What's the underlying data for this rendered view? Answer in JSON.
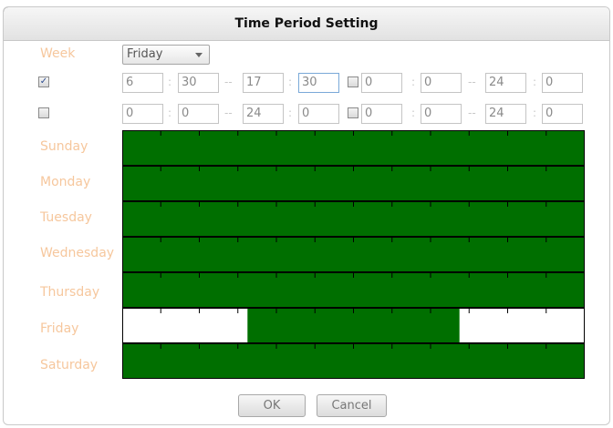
{
  "dialog": {
    "title": "Time Period Setting",
    "ok_label": "OK",
    "cancel_label": "Cancel"
  },
  "week": {
    "label": "Week",
    "selected": "Friday"
  },
  "separators": {
    "colon": ":",
    "dash": "--"
  },
  "period_rows": [
    {
      "checked": true,
      "check_glyph": "✓",
      "p1": {
        "sh": "6",
        "sm": "30",
        "eh": "17",
        "em": "30"
      },
      "p2_checked": false,
      "p2": {
        "sh": "0",
        "sm": "0",
        "eh": "24",
        "em": "0"
      }
    },
    {
      "checked": false,
      "check_glyph": "",
      "p1": {
        "sh": "0",
        "sm": "0",
        "eh": "24",
        "em": "0"
      },
      "p2_checked": false,
      "p2": {
        "sh": "0",
        "sm": "0",
        "eh": "24",
        "em": "0"
      }
    }
  ],
  "days": [
    "Sunday",
    "Monday",
    "Tuesday",
    "Wednesday",
    "Thursday",
    "Friday",
    "Saturday"
  ],
  "schedule": {
    "hours_total": 24,
    "colors": {
      "active": "#006f00",
      "inactive": "#ffffff",
      "tick": "#000000"
    },
    "rows": [
      {
        "day": "Sunday",
        "active": [
          [
            0,
            24
          ]
        ]
      },
      {
        "day": "Monday",
        "active": [
          [
            0,
            24
          ]
        ]
      },
      {
        "day": "Tuesday",
        "active": [
          [
            0,
            24
          ]
        ]
      },
      {
        "day": "Wednesday",
        "active": [
          [
            0,
            24
          ]
        ]
      },
      {
        "day": "Thursday",
        "active": [
          [
            0,
            24
          ]
        ]
      },
      {
        "day": "Friday",
        "active": [
          [
            6.5,
            17.5
          ]
        ]
      },
      {
        "day": "Saturday",
        "active": [
          [
            0,
            24
          ]
        ]
      }
    ]
  }
}
